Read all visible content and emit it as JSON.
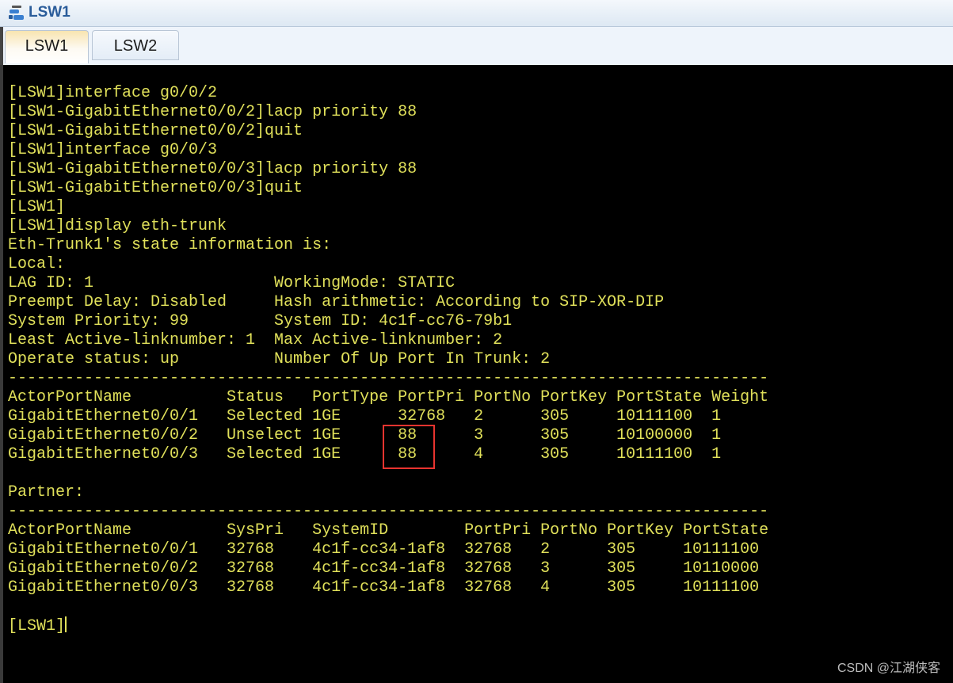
{
  "window": {
    "title": "LSW1",
    "icon": "switch-icon"
  },
  "tabs": [
    {
      "label": "LSW1",
      "active": true
    },
    {
      "label": "LSW2",
      "active": false
    }
  ],
  "terminal": {
    "text_color": "#e0e05a",
    "lines": [
      "[LSW1]interface g0/0/2",
      "[LSW1-GigabitEthernet0/0/2]lacp priority 88",
      "[LSW1-GigabitEthernet0/0/2]quit",
      "[LSW1]interface g0/0/3",
      "[LSW1-GigabitEthernet0/0/3]lacp priority 88",
      "[LSW1-GigabitEthernet0/0/3]quit",
      "[LSW1]",
      "[LSW1]display eth-trunk",
      "Eth-Trunk1's state information is:",
      "Local:",
      "LAG ID: 1                   WorkingMode: STATIC",
      "Preempt Delay: Disabled     Hash arithmetic: According to SIP-XOR-DIP",
      "System Priority: 99         System ID: 4c1f-cc76-79b1",
      "Least Active-linknumber: 1  Max Active-linknumber: 2",
      "Operate status: up          Number Of Up Port In Trunk: 2",
      "--------------------------------------------------------------------------------",
      "ActorPortName          Status   PortType PortPri PortNo PortKey PortState Weight",
      "GigabitEthernet0/0/1   Selected 1GE      32768   2      305     10111100  1",
      "GigabitEthernet0/0/2   Unselect 1GE      88      3      305     10100000  1",
      "GigabitEthernet0/0/3   Selected 1GE      88      4      305     10111100  1",
      "",
      "Partner:",
      "--------------------------------------------------------------------------------",
      "ActorPortName          SysPri   SystemID        PortPri PortNo PortKey PortState",
      "GigabitEthernet0/0/1   32768    4c1f-cc34-1af8  32768   2      305     10111100",
      "GigabitEthernet0/0/2   32768    4c1f-cc34-1af8  32768   3      305     10110000",
      "GigabitEthernet0/0/3   32768    4c1f-cc34-1af8  32768   4      305     10111100",
      "",
      "[LSW1]"
    ],
    "highlight_color": "#e8342f"
  },
  "watermark": "CSDN @江湖侠客"
}
